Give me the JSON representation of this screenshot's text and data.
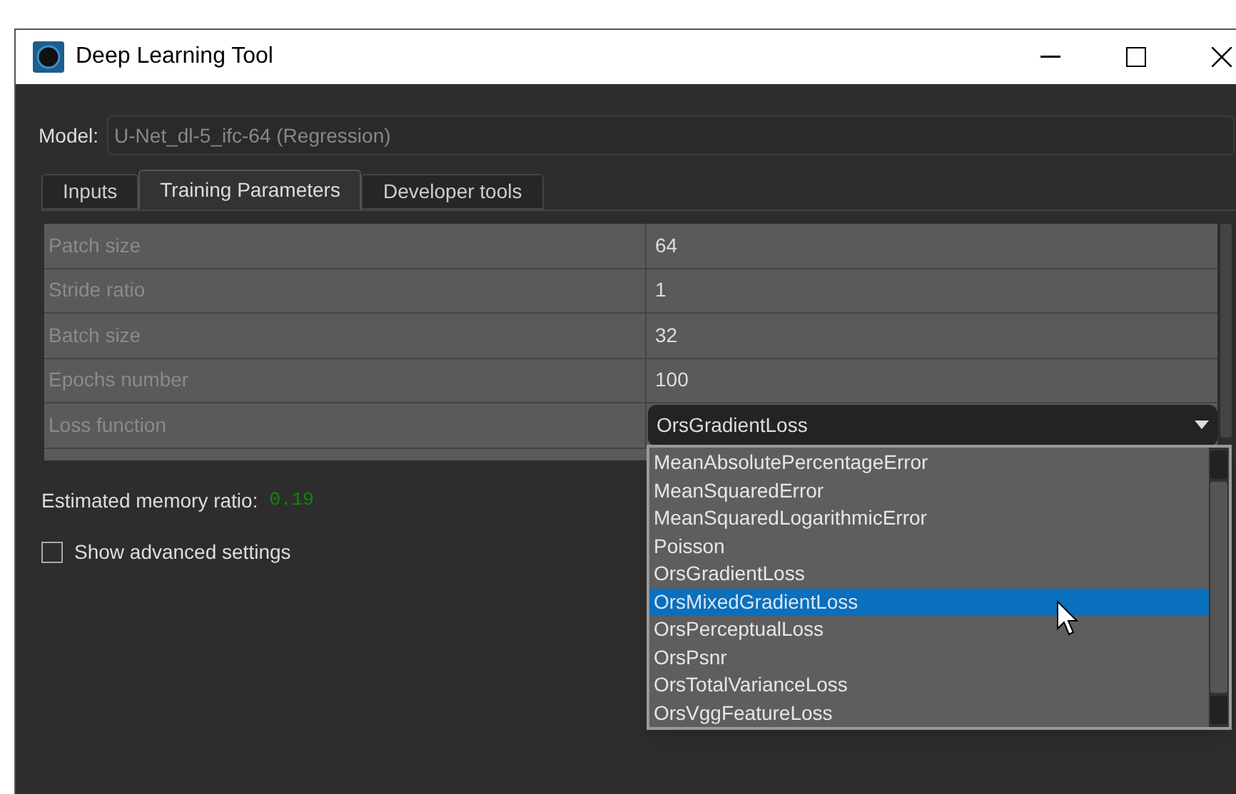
{
  "window": {
    "title": "Deep Learning Tool"
  },
  "model": {
    "label": "Model:",
    "value": "U-Net_dl-5_ifc-64 (Regression)"
  },
  "tabs": [
    {
      "label": "Inputs",
      "selected": false
    },
    {
      "label": "Training Parameters",
      "selected": true
    },
    {
      "label": "Developer tools",
      "selected": false
    }
  ],
  "parameters": [
    {
      "name": "Patch size",
      "value": "64",
      "kind": "text"
    },
    {
      "name": "Stride ratio",
      "value": "1",
      "kind": "text"
    },
    {
      "name": "Batch size",
      "value": "32",
      "kind": "text"
    },
    {
      "name": "Epochs number",
      "value": "100",
      "kind": "text"
    },
    {
      "name": "Loss function",
      "value": "OrsGradientLoss",
      "kind": "dropdown"
    }
  ],
  "dropdown_options": [
    {
      "label": "MeanAbsolutePercentageError",
      "selected": false
    },
    {
      "label": "MeanSquaredError",
      "selected": false
    },
    {
      "label": "MeanSquaredLogarithmicError",
      "selected": false
    },
    {
      "label": "Poisson",
      "selected": false
    },
    {
      "label": "OrsGradientLoss",
      "selected": false
    },
    {
      "label": "OrsMixedGradientLoss",
      "selected": true
    },
    {
      "label": "OrsPerceptualLoss",
      "selected": false
    },
    {
      "label": "OrsPsnr",
      "selected": false
    },
    {
      "label": "OrsTotalVarianceLoss",
      "selected": false
    },
    {
      "label": "OrsVggFeatureLoss",
      "selected": false
    }
  ],
  "memory": {
    "label": "Estimated memory ratio:",
    "value": "0.19"
  },
  "advanced": {
    "label": "Show advanced settings",
    "checked": false
  }
}
